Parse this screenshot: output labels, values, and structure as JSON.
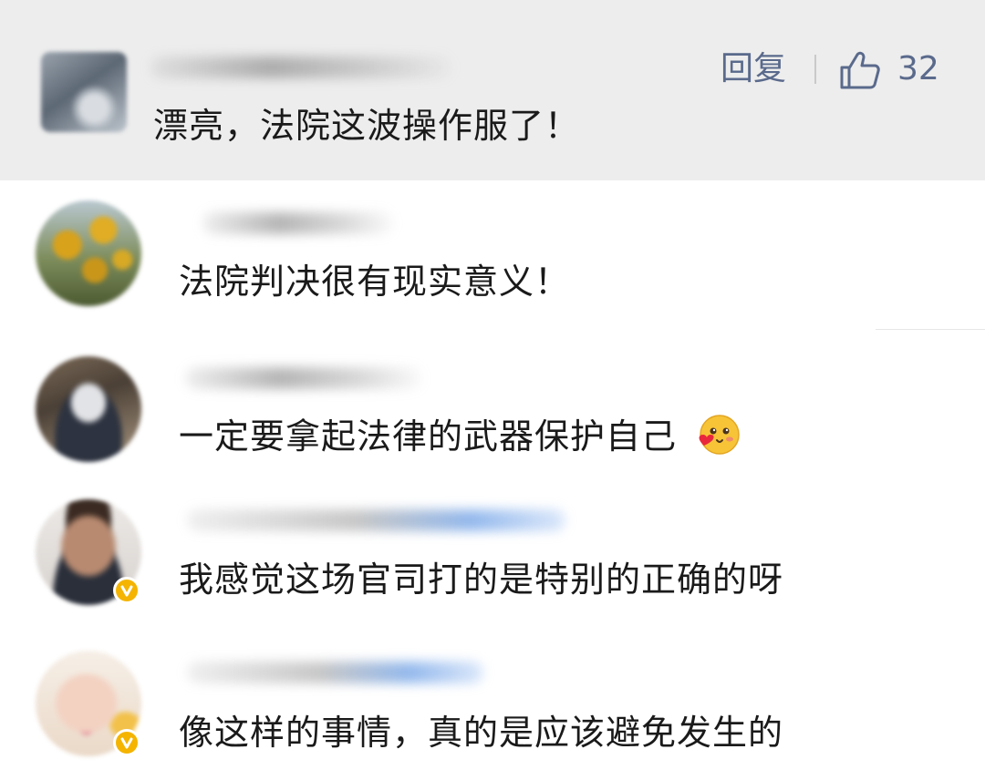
{
  "top_comment": {
    "text": "漂亮，法院这波操作服了！",
    "reply_label": "回复",
    "like_count": "32",
    "like_icon": "thumbs-up-icon"
  },
  "replies": [
    {
      "text": "法院判决很有现实意义！",
      "verified": false
    },
    {
      "text": "一定要拿起法律的武器保护自己",
      "emoji": "blush-heart-emoji",
      "verified": false
    },
    {
      "text": "我感觉这场官司打的是特别的正确的呀",
      "verified": true
    },
    {
      "text": "像这样的事情，真的是应该避免发生的",
      "verified": true
    }
  ],
  "colors": {
    "top_background": "#ededed",
    "action_color": "#5a6a8c",
    "verified_badge": "#f4b400"
  }
}
